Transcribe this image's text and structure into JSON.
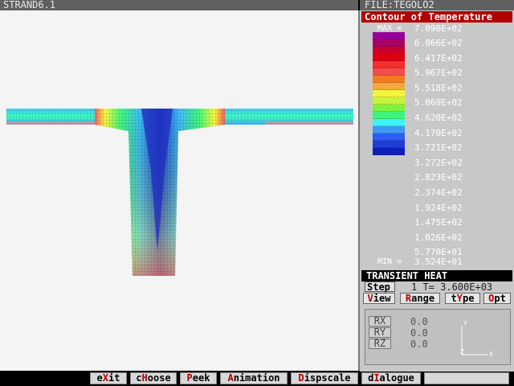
{
  "window": {
    "title": "STRAND6.1",
    "file": "FILE:TEGOLO2"
  },
  "legend": {
    "title": "Contour of Temperature",
    "max_label": "MAX =",
    "max_value": "7.090E+02",
    "min_label": "MIN =",
    "min_value": "3.524E+01",
    "levels": [
      "6.866E+02",
      "6.417E+02",
      "5.967E+02",
      "5.518E+02",
      "5.069E+02",
      "4.620E+02",
      "4.170E+02",
      "3.721E+02",
      "3.272E+02",
      "2.823E+02",
      "2.374E+02",
      "1.924E+02",
      "1.475E+02",
      "1.026E+02",
      "5.770E+01"
    ],
    "colors": [
      "#a000a0",
      "#b0006a",
      "#d00030",
      "#e80010",
      "#ff3030",
      "#ff5050",
      "#ff8020",
      "#ffb040",
      "#ffff40",
      "#d0ff40",
      "#80ff40",
      "#40ff80",
      "#40ffff",
      "#40a0ff",
      "#3060ff",
      "#2040e0",
      "#1020c0"
    ]
  },
  "analysis": {
    "mode": "TRANSIENT HEAT",
    "step_label": "Step",
    "step_value": "1 T= 3.600E+03"
  },
  "menu": {
    "view": {
      "hot": "V",
      "rest": "iew"
    },
    "range": {
      "hot": "R",
      "rest": "ange"
    },
    "type": {
      "pre": "t",
      "hot": "Y",
      "rest": "pe"
    },
    "opt": {
      "hot": "O",
      "rest": "pt"
    }
  },
  "rotation": {
    "rx_label": "RX",
    "rx_value": "0.0",
    "ry_label": "RY",
    "ry_value": "0.0",
    "rz_label": "RZ",
    "rz_value": "0.0",
    "axis_y": "Y",
    "axis_z": "Z",
    "axis_x": "X"
  },
  "bottom": {
    "exit": {
      "pre": "e",
      "hot": "X",
      "rest": "it"
    },
    "choose": {
      "pre": "c",
      "hot": "H",
      "rest": "oose"
    },
    "peek": {
      "hot": "P",
      "rest": "eek"
    },
    "animation": {
      "hot": "A",
      "rest": "nimation"
    },
    "dispscale": {
      "hot": "D",
      "rest": "ispscale"
    },
    "dialogue": {
      "pre": "d",
      "hot": "I",
      "rest": "alogue"
    }
  }
}
